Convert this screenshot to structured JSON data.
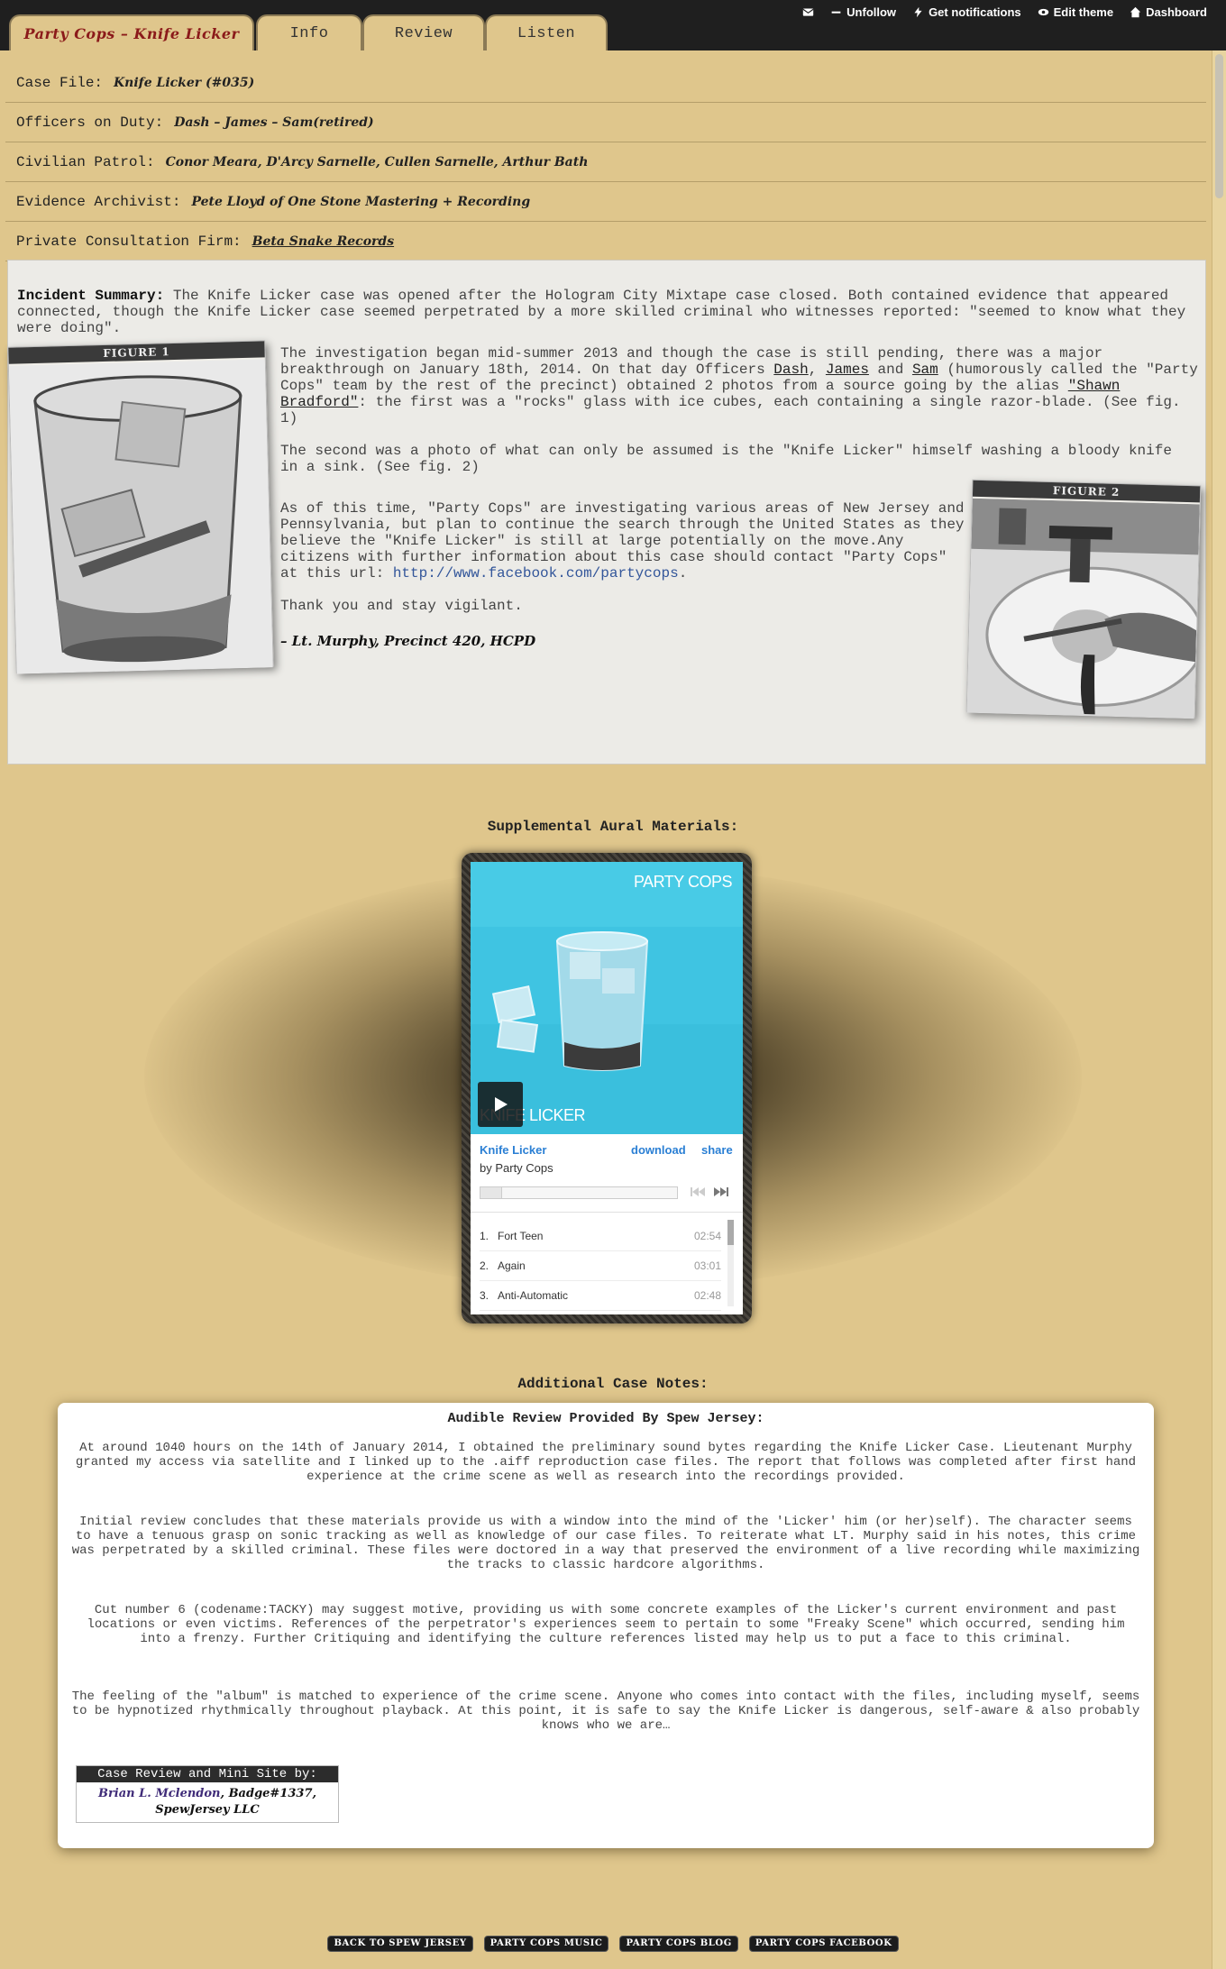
{
  "header": {
    "tabs": [
      {
        "label": "Party Cops – Knife Licker",
        "active": true
      },
      {
        "label": "Info"
      },
      {
        "label": "Review"
      },
      {
        "label": "Listen"
      }
    ],
    "controls": {
      "unfollow": "Unfollow",
      "notifications": "Get notifications",
      "edit_theme": "Edit theme",
      "dashboard": "Dashboard"
    }
  },
  "case": {
    "case_file": {
      "label": "Case File:",
      "value": "Knife Licker (#035)"
    },
    "officers": {
      "label": "Officers on Duty:",
      "value": "Dash – James – Sam(retired)"
    },
    "civilian": {
      "label": "Civilian Patrol:",
      "value": "Conor Meara, D'Arcy Sarnelle, Cullen Sarnelle, Arthur Bath"
    },
    "archivist": {
      "label": "Evidence Archivist:",
      "value": "Pete Lloyd of One Stone Mastering + Recording"
    },
    "firm": {
      "label": "Private Consultation Firm:",
      "value": "Beta Snake Records"
    }
  },
  "incident": {
    "summary_label": "Incident Summary:",
    "summary_text": " The Knife Licker case was opened after the Hologram City Mixtape case closed. Both contained evidence that appeared connected, though the Knife Licker case seemed perpetrated by a more skilled criminal who witnesses reported: \"seemed to know what they were doing\".",
    "para2_a": "The investigation began mid-summer 2013 and though the case is still pending, there was a major breakthrough on January 18th, 2014. On that day Officers ",
    "officer_dash": "Dash",
    "comma1": ", ",
    "officer_james": "James",
    "and_word": " and ",
    "officer_sam": "Sam",
    "para2_b": " (humorously called the \"Party Cops\" team by the rest of the precinct) obtained 2 photos from a source going by the alias ",
    "alias": "\"Shawn Bradford\"",
    "para2_c": ": the first was a \"rocks\" glass with ice cubes, each containing a single razor-blade. (See fig. 1)",
    "para3": "The second was a photo of what can only be assumed is the \"Knife Licker\" himself washing a bloody knife in a sink. (See fig. 2)",
    "para4_a": "As of this time, \"Party Cops\" are investigating various areas of New Jersey and Pennsylvania, but plan to continue the search through the United States as they believe the \"Knife Licker\" is still at large potentially on the move.Any citizens with further information about this case should contact \"Party Cops\" at this url: ",
    "fb_url": "http://www.facebook.com/partycops",
    "para4_b": ".",
    "para5": "Thank you and stay vigilant.",
    "signature": "– Lt. Murphy, Precinct 420, HCPD",
    "fig1": "FIGURE 1",
    "fig2": "FIGURE 2"
  },
  "supplemental": {
    "title": "Supplemental Aural Materials:",
    "player": {
      "art_title": "PARTY COPS",
      "art_subtitle": "KNIFE LICKER",
      "track_title": "Knife Licker",
      "by": "by Party Cops",
      "download": "download",
      "share": "share",
      "tracks": [
        {
          "num": "1.",
          "name": "Fort Teen",
          "time": "02:54"
        },
        {
          "num": "2.",
          "name": "Again",
          "time": "03:01"
        },
        {
          "num": "3.",
          "name": "Anti-Automatic",
          "time": "02:48"
        }
      ]
    }
  },
  "notes": {
    "title": "Additional Case Notes:",
    "review_title": "Audible Review Provided By Spew Jersey:",
    "p1": "At around 1040 hours on the 14th of January 2014, I obtained the preliminary sound bytes regarding the Knife Licker Case. Lieutenant Murphy granted my access via satellite and I linked up to the .aiff reproduction case files. The report that follows was completed after first hand experience at the crime scene as well as research into the recordings provided.",
    "p2": "Initial review concludes that these materials provide us with a window into the mind of the 'Licker' him (or her)self). The character seems to have a tenuous grasp on sonic tracking as well as knowledge of our case files. To reiterate what LT. Murphy said in his notes, this crime was perpetrated by a skilled criminal. These files were doctored in a way that preserved the environment of a live recording while maximizing the tracks to classic hardcore algorithms.",
    "p3": "Cut number 6 (codename:TACKY) may suggest motive, providing us with some concrete examples of the Licker's current environment and past locations or even victims. References of the perpetrator's experiences seem to pertain to some \"Freaky Scene\" which occurred, sending him into a frenzy. Further Critiquing and identifying the culture references listed may help us to put a face to this criminal.",
    "p4": "The feeling of the \"album\" is matched to experience of the crime scene. Anyone who comes into contact with the files, including myself, seems to be hypnotized rhythmically throughout playback. At this point, it is safe to say the Knife Licker is dangerous, self-aware & also probably knows who we are…",
    "credit_head": "Case Review and Mini Site by:",
    "credit_name": "Brian L. Mclendon",
    "credit_rest": ", Badge#1337,",
    "credit_org": "SpewJersey LLC"
  },
  "footer": {
    "links": [
      "BACK TO SPEW JERSEY",
      "PARTY COPS MUSIC",
      "PARTY COPS BLOG",
      "PARTY COPS FACEBOOK"
    ]
  }
}
